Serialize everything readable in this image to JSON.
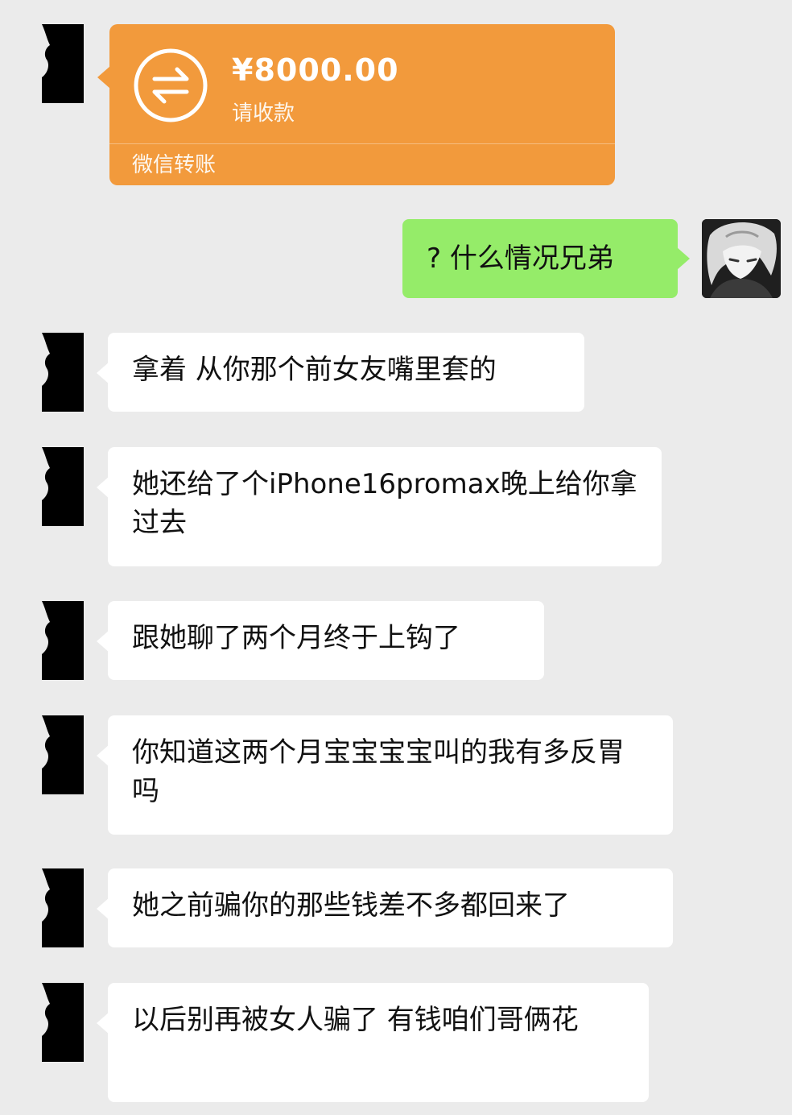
{
  "transfer": {
    "amount": "¥8000.00",
    "status": "请收款",
    "footer": "微信转账",
    "icon": "transfer-arrows-icon",
    "color": "#f29a3c"
  },
  "outgoing": {
    "text": "? 什么情况兄弟",
    "color": "#95ec69"
  },
  "messages": [
    {
      "text": "拿着 从你那个前女友嘴里套的"
    },
    {
      "text": "她还给了个iPhone16promax晚上给你拿过去"
    },
    {
      "text": "跟她聊了两个月终于上钩了"
    },
    {
      "text": "你知道这两个月宝宝宝宝叫的我有多反胃吗"
    },
    {
      "text": "她之前骗你的那些钱差不多都回来了"
    },
    {
      "text": "以后别再被女人骗了 有钱咱们哥俩花"
    }
  ]
}
